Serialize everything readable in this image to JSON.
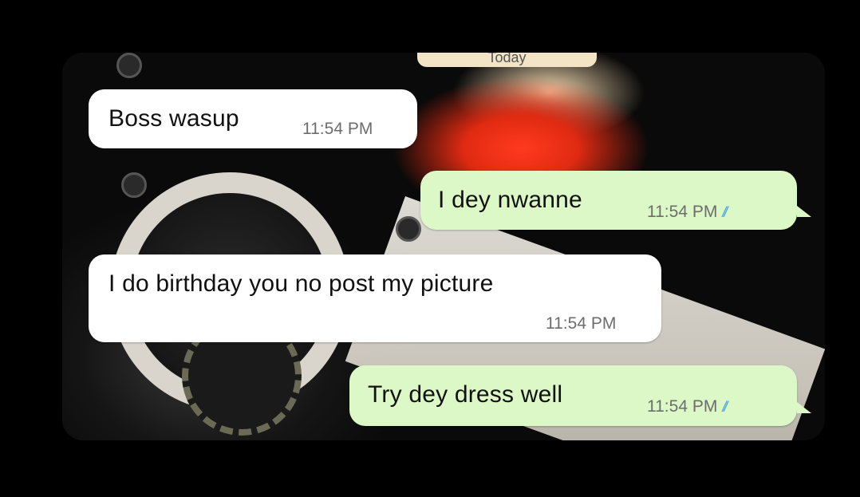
{
  "chat": {
    "date_label": "Today",
    "messages": [
      {
        "direction": "incoming",
        "text": "Boss wasup",
        "time": "11:54 PM"
      },
      {
        "direction": "outgoing",
        "text": "I dey nwanne",
        "time": "11:54 PM",
        "read_status": "read"
      },
      {
        "direction": "incoming",
        "text": "I do birthday you no post my picture",
        "time": "11:54 PM"
      },
      {
        "direction": "outgoing",
        "text": "Try dey dress well",
        "time": "11:54 PM",
        "read_status": "read"
      }
    ]
  },
  "colors": {
    "incoming_bubble": "#ffffff",
    "outgoing_bubble": "#dbf8c6",
    "read_ticks": "#4fa3e0"
  }
}
